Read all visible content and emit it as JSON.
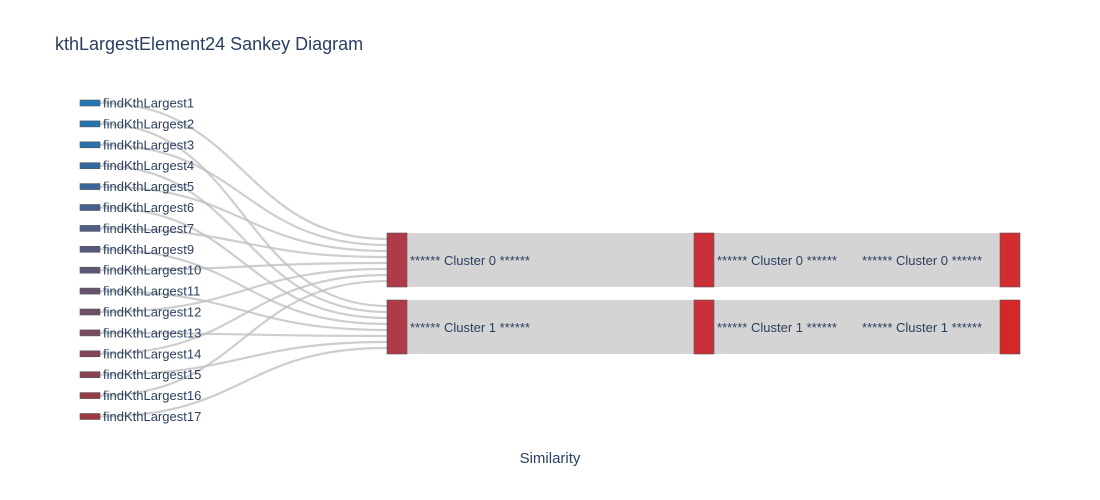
{
  "title": "kthLargestElement24 Sankey Diagram",
  "xlabel": "Similarity",
  "chart_data": {
    "type": "sankey",
    "title": "kthLargestElement24 Sankey Diagram",
    "xlabel": "Similarity",
    "sources": [
      {
        "label": "findKthLargest1",
        "color": "#1f77b4",
        "target": 0
      },
      {
        "label": "findKthLargest2",
        "color": "#2474b0",
        "target": 1
      },
      {
        "label": "findKthLargest3",
        "color": "#2a70aa",
        "target": 0
      },
      {
        "label": "findKthLargest4",
        "color": "#336aa0",
        "target": 1
      },
      {
        "label": "findKthLargest5",
        "color": "#3c6698",
        "target": 0
      },
      {
        "label": "findKthLargest6",
        "color": "#446290",
        "target": 1
      },
      {
        "label": "findKthLargest7",
        "color": "#4d5e88",
        "target": 0
      },
      {
        "label": "findKthLargest9",
        "color": "#565a80",
        "target": 1
      },
      {
        "label": "findKthLargest10",
        "color": "#5f5678",
        "target": 0
      },
      {
        "label": "findKthLargest11",
        "color": "#685270",
        "target": 1
      },
      {
        "label": "findKthLargest12",
        "color": "#714e68",
        "target": 0
      },
      {
        "label": "findKthLargest13",
        "color": "#7a4a60",
        "target": 1
      },
      {
        "label": "findKthLargest14",
        "color": "#834658",
        "target": 0
      },
      {
        "label": "findKthLargest15",
        "color": "#8c4250",
        "target": 1
      },
      {
        "label": "findKthLargest16",
        "color": "#953e48",
        "target": 0
      },
      {
        "label": "findKthLargest17",
        "color": "#9e3a42",
        "target": 1
      }
    ],
    "stages": [
      {
        "labels": [
          "****** Cluster 0 ******",
          "****** Cluster 1 ******"
        ],
        "colors": [
          "#b03a48",
          "#b03a48"
        ]
      },
      {
        "labels": [
          "****** Cluster 0 ******",
          "****** Cluster 1 ******"
        ],
        "colors": [
          "#c8303a",
          "#c8303a"
        ]
      },
      {
        "labels": [
          "****** Cluster 0 ******",
          "****** Cluster 1 ******"
        ],
        "colors": [
          "#d22c30",
          "#d62728"
        ]
      }
    ]
  }
}
